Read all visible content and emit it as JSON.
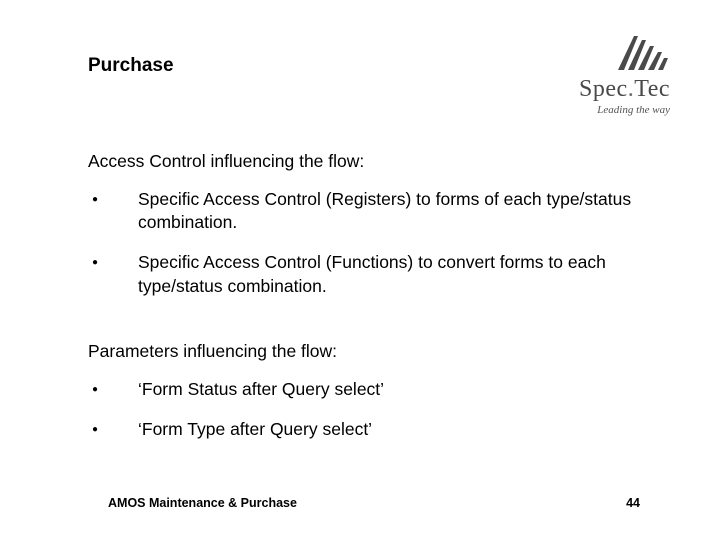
{
  "title": "Purchase",
  "logo": {
    "brand_a": "Spec",
    "brand_dot": ".",
    "brand_b": "Tec",
    "tagline": "Leading the way"
  },
  "section1": {
    "heading": "Access Control influencing the flow:",
    "items": [
      "Specific Access Control (Registers) to forms of each type/status combination.",
      "Specific Access Control (Functions) to convert forms to each type/status combination."
    ]
  },
  "section2": {
    "heading": "Parameters influencing the flow:",
    "items": [
      "‘Form Status after Query select’",
      "‘Form Type after Query select’"
    ]
  },
  "footer": {
    "left": "AMOS Maintenance & Purchase",
    "page": "44"
  }
}
